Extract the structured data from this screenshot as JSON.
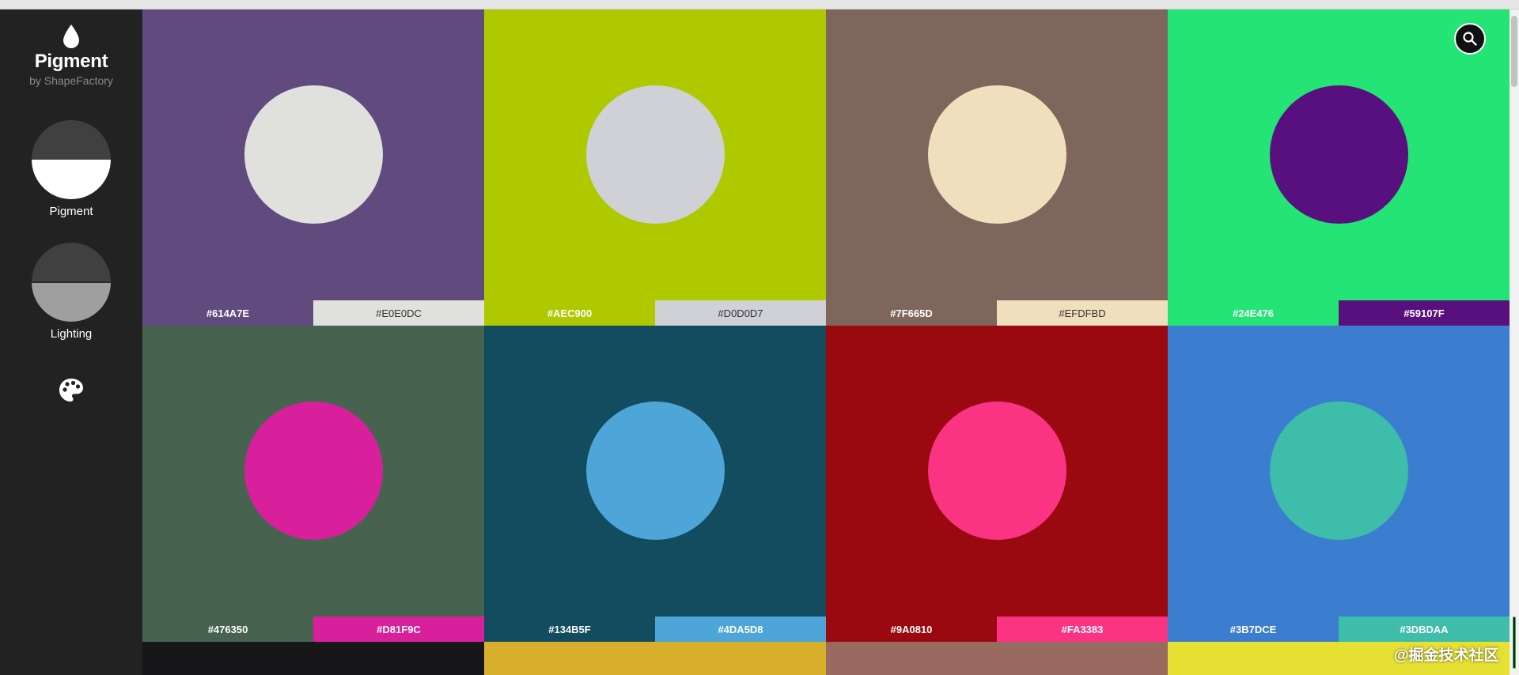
{
  "brand": {
    "title": "Pigment",
    "subtitle": "by ShapeFactory"
  },
  "sidebar": {
    "modes": [
      {
        "label": "Pigment",
        "top_color": "#404040",
        "bottom_color": "#ffffff"
      },
      {
        "label": "Lighting",
        "top_color": "#404040",
        "bottom_color": "#9f9f9f"
      }
    ],
    "palette_icon": "palette-icon"
  },
  "search_icon": "search-icon",
  "watermark": "@掘金技术社区",
  "pairs": [
    {
      "bg": "#614A7E",
      "fg": "#E0E0DC",
      "label_bg": "#614A7E",
      "label_fg": "#E0E0DC",
      "label_bg_text": "#ffffff",
      "label_fg_text": "#333333"
    },
    {
      "bg": "#AEC900",
      "fg": "#D0D0D7",
      "label_bg": "#AEC900",
      "label_fg": "#D0D0D7",
      "label_bg_text": "#ffffff",
      "label_fg_text": "#333333"
    },
    {
      "bg": "#7F665D",
      "fg": "#EFDFBD",
      "label_bg": "#7F665D",
      "label_fg": "#EFDFBD",
      "label_bg_text": "#ffffff",
      "label_fg_text": "#333333"
    },
    {
      "bg": "#24E476",
      "fg": "#59107F",
      "label_bg": "#24E476",
      "label_fg": "#59107F",
      "label_bg_text": "#ffffff",
      "label_fg_text": "#ffffff"
    },
    {
      "bg": "#476350",
      "fg": "#D81F9C",
      "label_bg": "#476350",
      "label_fg": "#D81F9C",
      "label_bg_text": "#ffffff",
      "label_fg_text": "#ffffff"
    },
    {
      "bg": "#134B5F",
      "fg": "#4DA5D8",
      "label_bg": "#134B5F",
      "label_fg": "#4DA5D8",
      "label_bg_text": "#ffffff",
      "label_fg_text": "#ffffff"
    },
    {
      "bg": "#9A0810",
      "fg": "#FA3383",
      "label_bg": "#9A0810",
      "label_fg": "#FA3383",
      "label_bg_text": "#ffffff",
      "label_fg_text": "#ffffff"
    },
    {
      "bg": "#3B7DCE",
      "fg": "#3DBDAA",
      "label_bg": "#3B7DCE",
      "label_fg": "#3DBDAA",
      "label_bg_text": "#ffffff",
      "label_fg_text": "#ffffff"
    }
  ],
  "partial_row_colors": [
    "#17171A",
    "#D8AF2D",
    "#996B60",
    "#E6E032"
  ]
}
